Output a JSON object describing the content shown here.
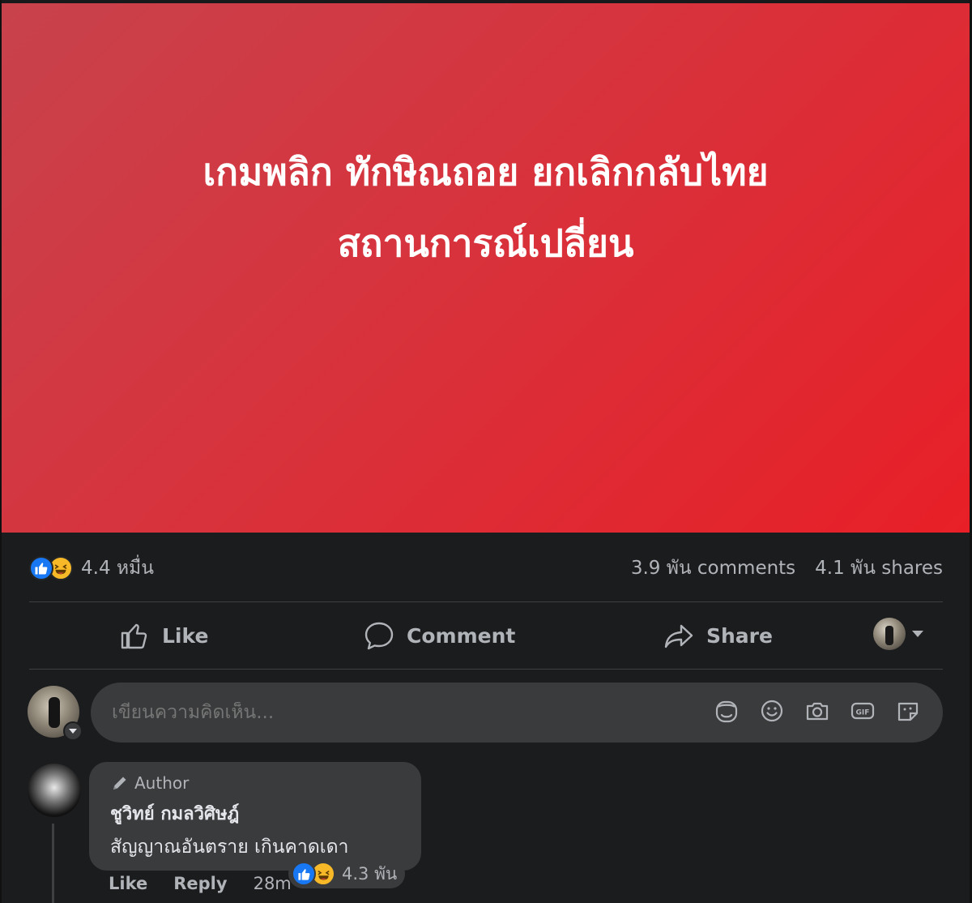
{
  "post": {
    "headline_line1": "เกมพลิก ทักษิณถอย ยกเลิกกลับไทย",
    "headline_line2": "สถานการณ์เปลี่ยน",
    "hero_colors": [
      "#c8424c",
      "#e81f27"
    ]
  },
  "stats": {
    "reaction_icons": [
      "like-icon",
      "haha-icon"
    ],
    "reaction_count": "4.4 หมื่น",
    "comments": "3.9 พัน comments",
    "shares": "4.1 พัน shares"
  },
  "actions": {
    "like_label": "Like",
    "comment_label": "Comment",
    "share_label": "Share"
  },
  "composer": {
    "placeholder": "เขียนความคิดเห็น...",
    "icons": [
      "avatar-sticker-icon",
      "emoji-icon",
      "camera-icon",
      "gif-icon",
      "sticker-icon"
    ]
  },
  "comment": {
    "badge": "Author",
    "author": "ชูวิทย์ กมลวิศิษฎ์",
    "text": "สัญญาณอันตราย เกินคาดเดา",
    "like_label": "Like",
    "reply_label": "Reply",
    "time": "28m",
    "reaction_count": "4.3 พัน"
  },
  "colors": {
    "background": "#1b1c1e",
    "surface": "#3a3b3c",
    "text_secondary": "#b0b3b8",
    "like_blue": "#1877f2",
    "haha_yellow": "#f7b928"
  }
}
